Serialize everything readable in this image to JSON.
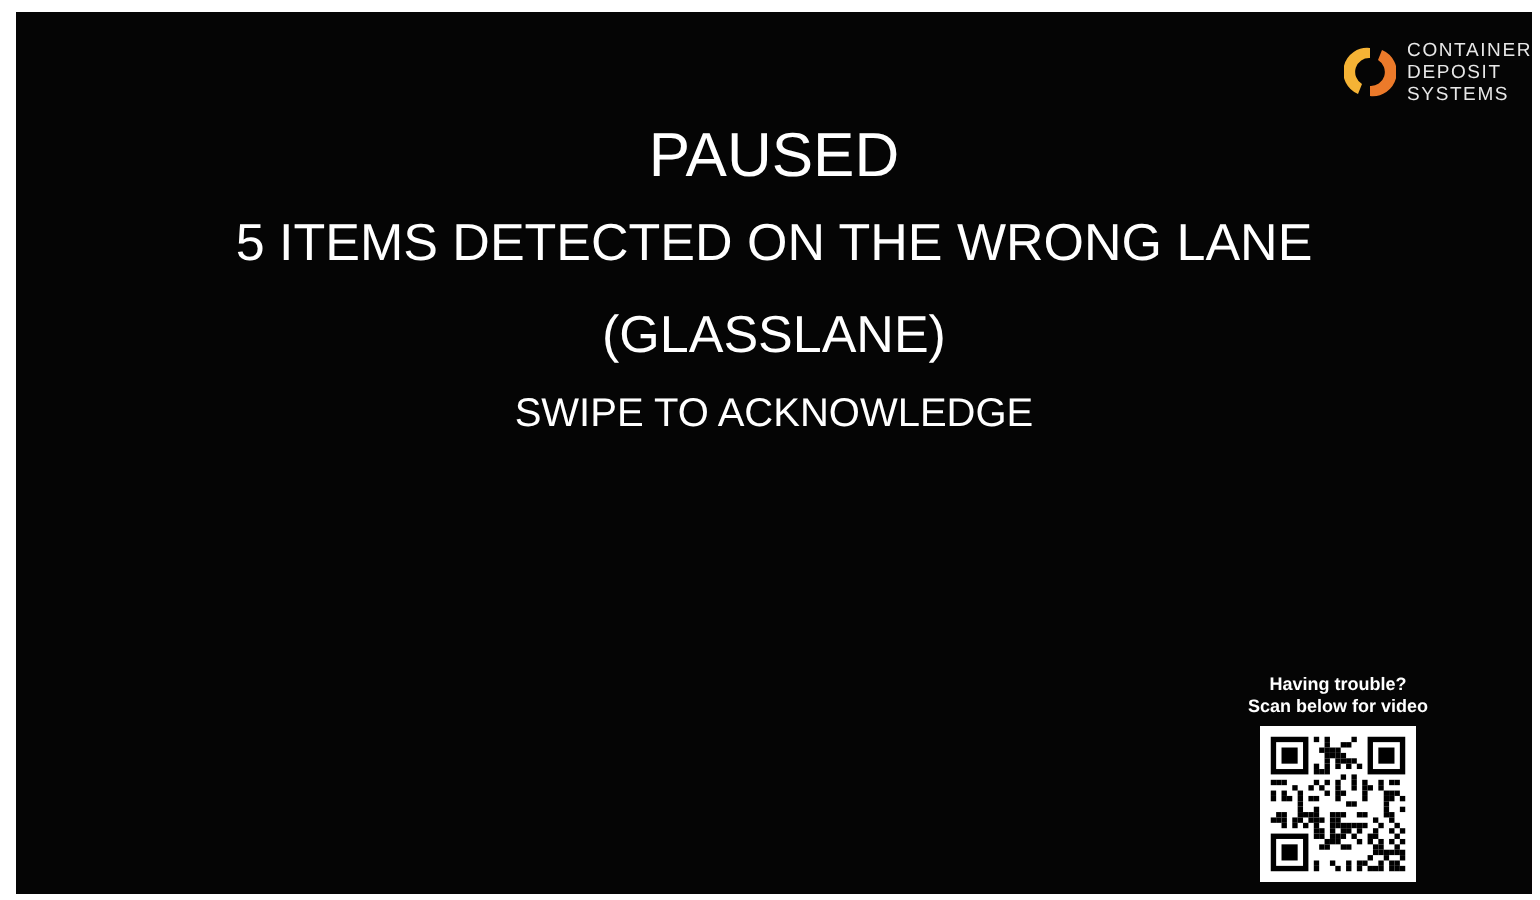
{
  "logo": {
    "lines": [
      "CONTAINER",
      "DEPOSIT",
      "SYSTEMS"
    ]
  },
  "message": {
    "title": "PAUSED",
    "lines": [
      "5 ITEMS DETECTED ON THE WRONG LANE",
      "(GLASSLANE)"
    ],
    "instruction": "SWIPE TO ACKNOWLEDGE"
  },
  "help": {
    "lines": [
      "Having trouble?",
      "Scan below for video"
    ]
  }
}
